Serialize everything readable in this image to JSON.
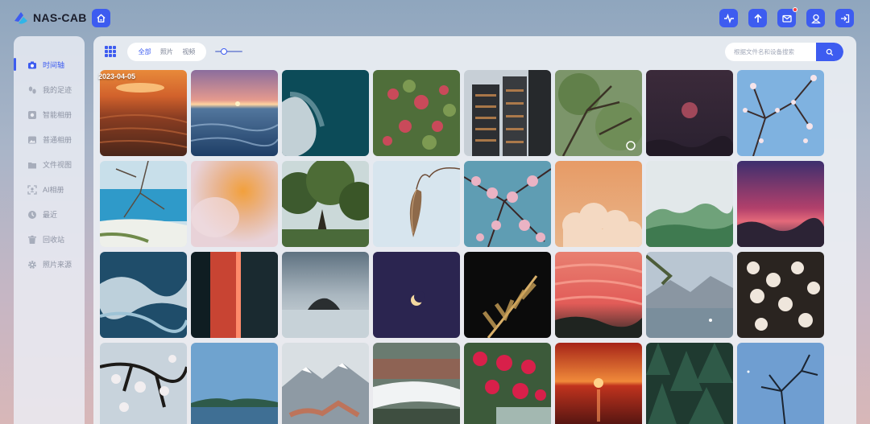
{
  "app": {
    "name": "NAS-CAB"
  },
  "sidebar": {
    "items": [
      {
        "label": "时间轴",
        "icon": "camera-icon",
        "active": true
      },
      {
        "label": "我的足迹",
        "icon": "footprint-icon",
        "active": false
      },
      {
        "label": "智能相册",
        "icon": "smart-album-icon",
        "active": false
      },
      {
        "label": "普通相册",
        "icon": "image-album-icon",
        "active": false
      },
      {
        "label": "文件视图",
        "icon": "folder-view-icon",
        "active": false
      },
      {
        "label": "AI相册",
        "icon": "ai-scan-icon",
        "active": false
      },
      {
        "label": "最近",
        "icon": "clock-icon",
        "active": false
      },
      {
        "label": "回收站",
        "icon": "trash-icon",
        "active": false
      },
      {
        "label": "照片来源",
        "icon": "gear-icon",
        "active": false
      }
    ]
  },
  "toolbar": {
    "filters": [
      "全部",
      "照片",
      "视频"
    ],
    "active_filter": "全部",
    "search_placeholder": "根据文件名和设备搜索"
  },
  "topbar": {
    "actions": [
      "activity-icon",
      "upload-icon",
      "mail-icon",
      "user-icon",
      "logout-icon"
    ]
  },
  "gallery": {
    "date": "2023-04-05",
    "photos": [
      "sunset-beach",
      "ocean-sunset",
      "aerial-wave",
      "red-flowers",
      "apartment-buildings",
      "tree-branches",
      "red-moon",
      "cherry-blossom-sky",
      "coastal-tree",
      "blurred-orange",
      "green-trees",
      "hanging-leaves",
      "pink-blossoms",
      "orange-clouds",
      "misty-forest",
      "pink-sky",
      "crashing-waves",
      "red-door",
      "sea-rock",
      "crescent-moon",
      "palm-leaves",
      "pink-clouds",
      "mountain-lake",
      "white-flowers",
      "blossom-branch",
      "blue-lake",
      "snowy-mountain",
      "forest-fog",
      "red-bougainvillea",
      "red-sunset-sea",
      "pine-forest",
      "tree-silhouette"
    ]
  },
  "colors": {
    "accent": "#3d5cf0",
    "notification": "#ff3b3b"
  }
}
